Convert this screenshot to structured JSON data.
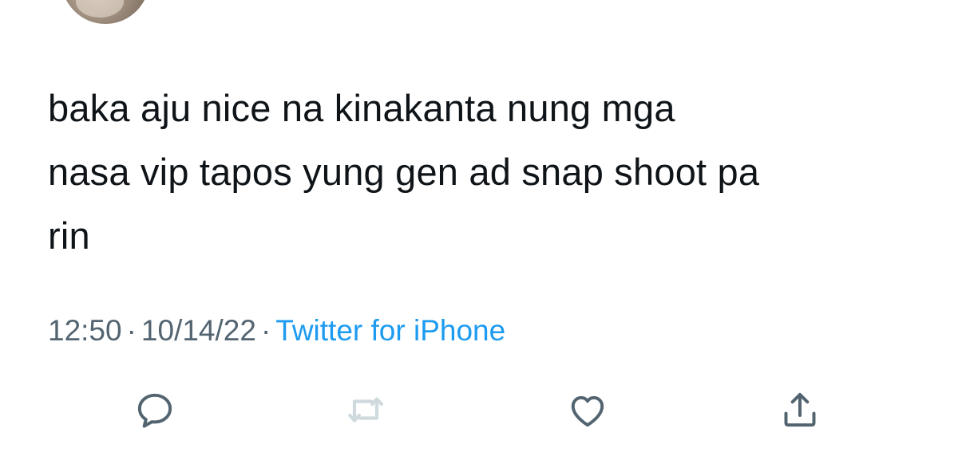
{
  "tweet": {
    "text_lines": [
      "baka aju nice na kinakanta nung mga",
      "nasa vip tapos yung gen ad snap shoot pa",
      "rin"
    ],
    "time": "12:50",
    "date": "10/14/22",
    "separator": "·",
    "source": "Twitter for iPhone"
  },
  "actions": [
    {
      "icon": "reply-icon",
      "enabled": true
    },
    {
      "icon": "retweet-icon",
      "enabled": false
    },
    {
      "icon": "like-icon",
      "enabled": true
    },
    {
      "icon": "share-icon",
      "enabled": true
    }
  ],
  "colors": {
    "text": "#0f1419",
    "secondary": "#536471",
    "link": "#1d9bf0",
    "icon": "#536471",
    "icon_disabled": "#cfd9de"
  }
}
